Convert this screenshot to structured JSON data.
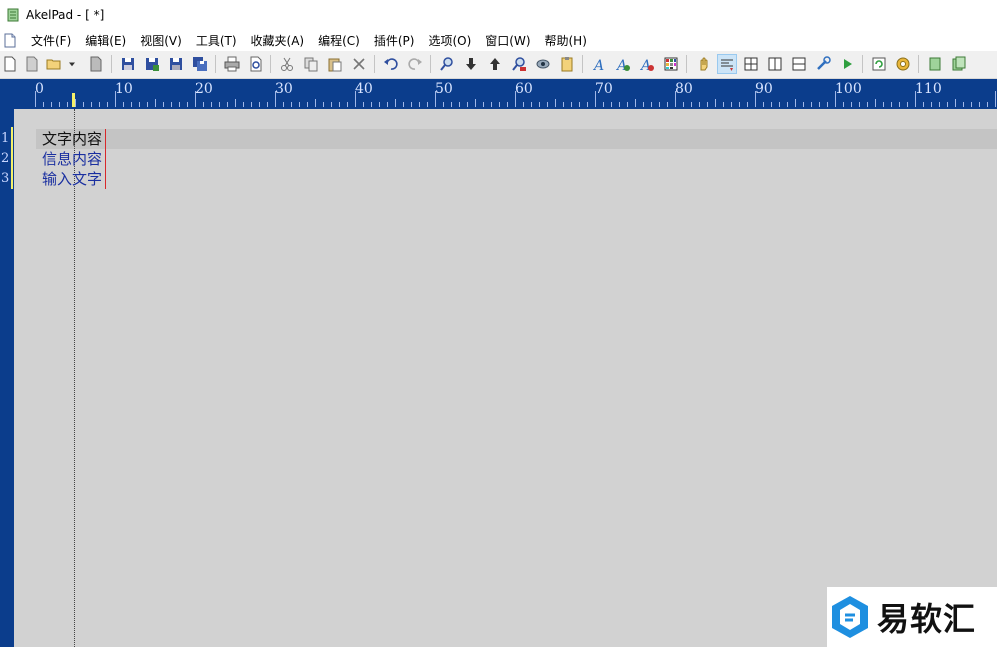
{
  "window": {
    "title": "AkelPad - [ *]"
  },
  "menu": {
    "items": [
      {
        "label": "文件(F)"
      },
      {
        "label": "编辑(E)"
      },
      {
        "label": "视图(V)"
      },
      {
        "label": "工具(T)"
      },
      {
        "label": "收藏夹(A)"
      },
      {
        "label": "编程(C)"
      },
      {
        "label": "插件(P)"
      },
      {
        "label": "选项(O)"
      },
      {
        "label": "窗口(W)"
      },
      {
        "label": "帮助(H)"
      }
    ]
  },
  "ruler": {
    "labels": [
      "0",
      "10",
      "20",
      "30",
      "40",
      "50",
      "60",
      "70",
      "80",
      "90",
      "100",
      "110"
    ]
  },
  "editor": {
    "lines": [
      {
        "num": "1",
        "text": "文字内容"
      },
      {
        "num": "2",
        "text": "信息内容"
      },
      {
        "num": "3",
        "text": "输入文字"
      }
    ],
    "colors": {
      "line1": "#111111",
      "other_lines": "#1a2fa0",
      "background": "#d2d2d2",
      "accent": "#0b3d8c"
    }
  },
  "watermark": {
    "text": "易软汇"
  },
  "icons": [
    "new-file-icon",
    "blank-file-icon",
    "open-folder-icon",
    "dropdown-arrow-icon",
    "recent-file-icon",
    "save-icon",
    "save-as-icon",
    "save-all-icon",
    "save-all-alt-icon",
    "print-icon",
    "print-preview-icon",
    "cut-icon",
    "copy-icon",
    "paste-icon",
    "delete-icon",
    "undo-icon",
    "redo-icon",
    "find-icon",
    "find-down-icon",
    "find-up-icon",
    "replace-icon",
    "goto-icon",
    "clipboard-icon",
    "font-icon",
    "font-bold-icon",
    "font-color-icon",
    "grid-icon",
    "hand-icon",
    "word-wrap-icon",
    "split-four-icon",
    "split-vertical-icon",
    "split-horizontal-icon",
    "wrench-icon",
    "run-icon",
    "refresh-icon",
    "settings-gear-icon",
    "notepad-icon",
    "notepad-multi-icon"
  ]
}
